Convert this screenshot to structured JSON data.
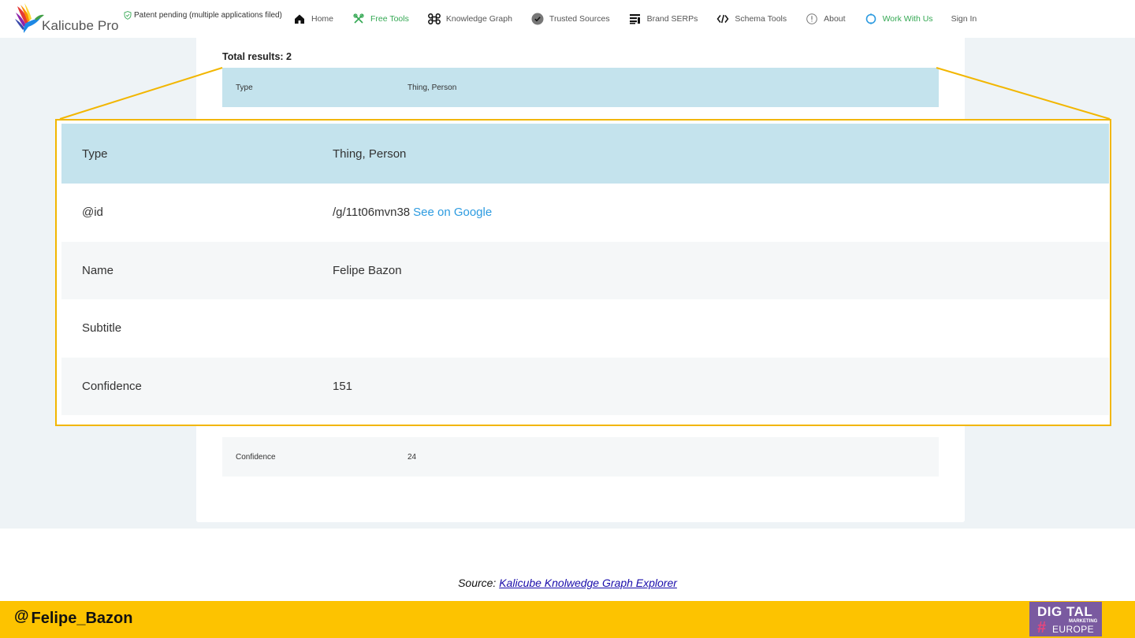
{
  "header": {
    "brand": "Kalicube Pro",
    "patent": "Patent pending (multiple applications filed)",
    "nav": [
      {
        "label": "Home",
        "icon": "home-icon"
      },
      {
        "label": "Free Tools",
        "icon": "tools-icon"
      },
      {
        "label": "Knowledge Graph",
        "icon": "command-icon"
      },
      {
        "label": "Trusted Sources",
        "icon": "check-circle-icon"
      },
      {
        "label": "Brand SERPs",
        "icon": "serp-icon"
      },
      {
        "label": "Schema Tools",
        "icon": "code-icon"
      },
      {
        "label": "About",
        "icon": "info-icon"
      },
      {
        "label": "Work With Us",
        "icon": "circle-icon"
      },
      {
        "label": "Sign In"
      }
    ]
  },
  "results": {
    "total": "Total results: 2",
    "type_row": {
      "key": "Type",
      "value": "Thing, Person"
    },
    "confidence_row": {
      "key": "Confidence",
      "value": "24"
    }
  },
  "zoom": {
    "rows": [
      {
        "key": "Type",
        "value": "Thing, Person"
      },
      {
        "key": "@id",
        "value": "/g/11t06mvn38",
        "link": "See on Google"
      },
      {
        "key": "Name",
        "value": "Felipe Bazon"
      },
      {
        "key": "Subtitle",
        "value": ""
      },
      {
        "key": "Confidence",
        "value": "151"
      }
    ]
  },
  "source": {
    "prefix": "Source:",
    "link": "Kalicube Knolwedge Graph Explorer"
  },
  "footer": {
    "at": "@",
    "handle": "Felipe_Bazon"
  },
  "badge": {
    "line1": "DIG TAL",
    "hash": "#",
    "line2": "MARKETING",
    "line3": "EUROPE"
  },
  "colors": {
    "accent_green": "#34a853",
    "highlight_blue": "#c4e3ed",
    "callout_yellow": "#f2b600",
    "footer_yellow": "#fdc300",
    "link_blue": "#2d9be0"
  }
}
